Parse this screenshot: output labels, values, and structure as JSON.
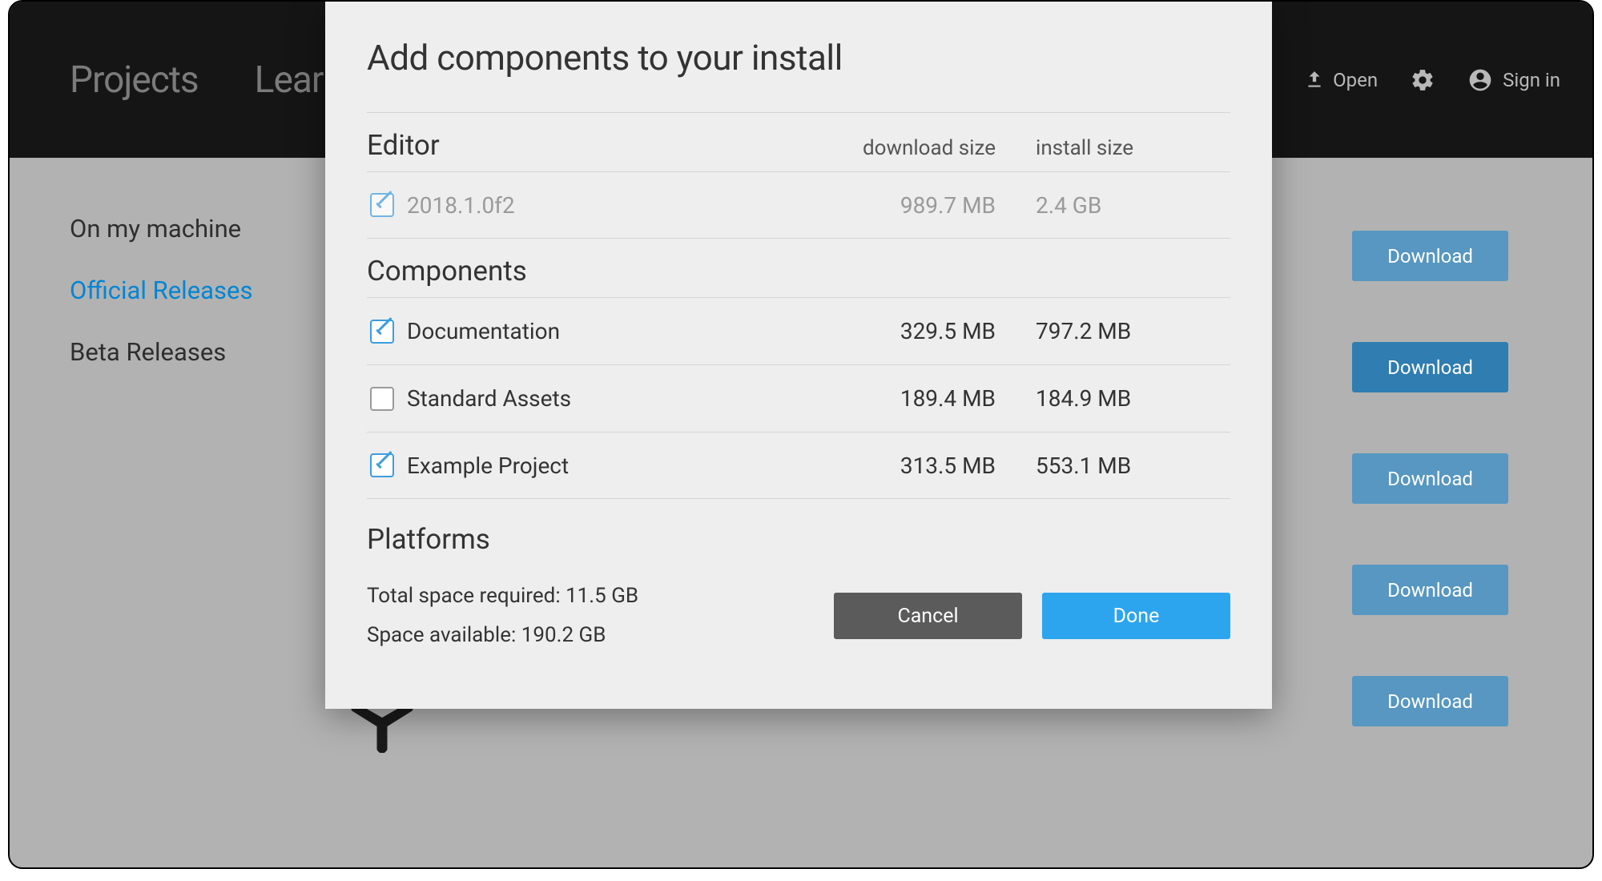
{
  "topnav": {
    "items": [
      "Projects",
      "Learn"
    ],
    "open_label": "Open",
    "signin_label": "Sign in"
  },
  "sidenav": {
    "items": [
      {
        "label": "On my machine",
        "active": false
      },
      {
        "label": "Official Releases",
        "active": true
      },
      {
        "label": "Beta Releases",
        "active": false
      }
    ]
  },
  "downloads": {
    "button_label": "Download",
    "rows": [
      {
        "light": true
      },
      {
        "light": false
      },
      {
        "light": true
      },
      {
        "light": true
      },
      {
        "light": true
      }
    ]
  },
  "modal": {
    "title": "Add components to your install",
    "section_editor": "Editor",
    "section_components": "Components",
    "section_platforms": "Platforms",
    "col_download": "download size",
    "col_install": "install size",
    "editor_row": {
      "label": "2018.1.0f2",
      "download": "989.7 MB",
      "install": "2.4 GB",
      "checked": true,
      "disabled": true
    },
    "component_rows": [
      {
        "label": "Documentation",
        "download": "329.5 MB",
        "install": "797.2 MB",
        "checked": true
      },
      {
        "label": "Standard Assets",
        "download": "189.4 MB",
        "install": "184.9 MB",
        "checked": false
      },
      {
        "label": "Example Project",
        "download": "313.5 MB",
        "install": "553.1 MB",
        "checked": true
      }
    ],
    "total_required": "Total space required: 11.5 GB",
    "space_available": "Space available: 190.2 GB",
    "cancel_label": "Cancel",
    "done_label": "Done"
  }
}
